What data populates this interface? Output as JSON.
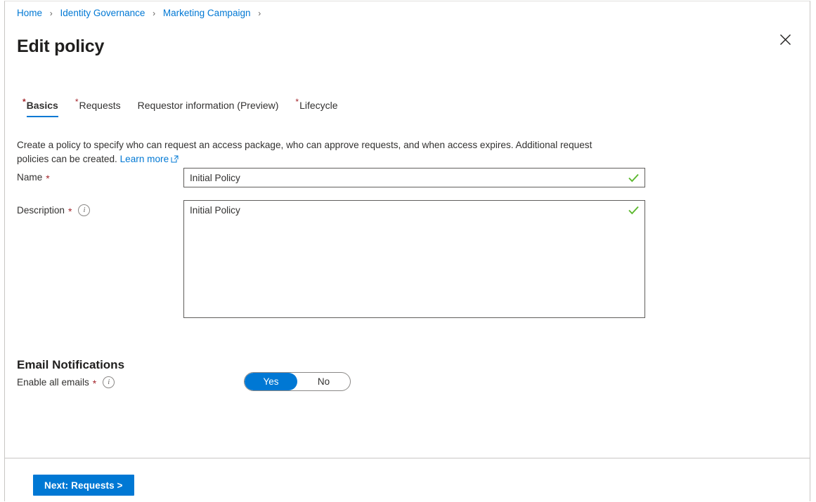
{
  "breadcrumb": {
    "items": [
      {
        "label": "Home"
      },
      {
        "label": "Identity Governance"
      },
      {
        "label": "Marketing Campaign"
      }
    ],
    "separator": "›"
  },
  "header": {
    "title": "Edit policy",
    "close_icon": "close-icon"
  },
  "tabs": [
    {
      "label": "Basics",
      "required": true,
      "active": true
    },
    {
      "label": "Requests",
      "required": true,
      "active": false
    },
    {
      "label": "Requestor information (Preview)",
      "required": false,
      "active": false
    },
    {
      "label": "Lifecycle",
      "required": true,
      "active": false
    }
  ],
  "intro": {
    "text": "Create a policy to specify who can request an access package, who can approve requests, and when access expires. Additional request policies can be created. ",
    "link_label": "Learn more",
    "link_icon": "external-link-icon"
  },
  "form": {
    "name": {
      "label": "Name",
      "required_marker": "*",
      "value": "Initial Policy",
      "placeholder": "",
      "valid_icon": "checkmark-icon"
    },
    "description": {
      "label": "Description",
      "required_marker": "*",
      "info_icon": "info-icon",
      "info_glyph": "i",
      "value": "Initial Policy",
      "placeholder": "",
      "valid_icon": "checkmark-icon"
    }
  },
  "email_notifications": {
    "heading": "Email Notifications",
    "enable_all": {
      "label": "Enable all emails",
      "required_marker": "*",
      "info_icon": "info-icon",
      "info_glyph": "i",
      "options": [
        "Yes",
        "No"
      ],
      "selected": "Yes"
    }
  },
  "footer": {
    "next_label": "Next: Requests >"
  },
  "colors": {
    "accent": "#0078d4",
    "link": "#0078d4",
    "required_star": "#a4262c",
    "valid_check": "#5cb82e",
    "border": "#605e5c",
    "text": "#323130"
  }
}
